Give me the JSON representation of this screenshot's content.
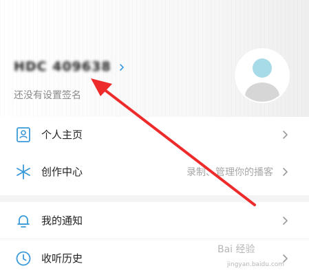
{
  "profile": {
    "username": "HDC 409638",
    "signature": "还没有设置签名"
  },
  "menu": {
    "items": [
      {
        "label": "个人主页",
        "hint": "",
        "icon": "person-card-icon"
      },
      {
        "label": "创作中心",
        "hint": "录制、管理你的播客",
        "icon": "sparkle-icon"
      },
      {
        "label": "我的通知",
        "hint": "",
        "icon": "bell-icon"
      },
      {
        "label": "收听历史",
        "hint": "",
        "icon": "clock-icon"
      }
    ]
  },
  "watermark": {
    "text": "Bai 经验",
    "sub": "jingyan.baidu.com"
  },
  "colors": {
    "accent": "#3a9ad9",
    "annotation_arrow": "#ee2b2b",
    "chevron": "#9a9a9a",
    "avatar_head": "#a8dbe8",
    "avatar_body": "#d6d6d6"
  }
}
